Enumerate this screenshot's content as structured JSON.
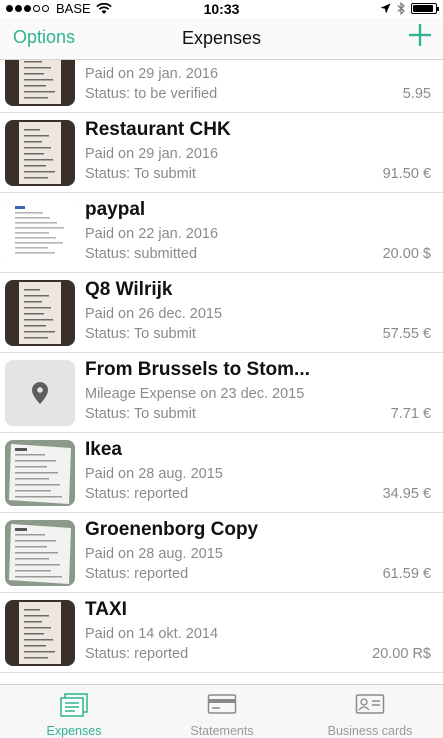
{
  "status_bar": {
    "carrier": "BASE",
    "time": "10:33",
    "battery_level": 0.92
  },
  "nav": {
    "left_label": "Options",
    "title": "Expenses",
    "add_icon": "plus-icon",
    "accent_color": "#2fb38f"
  },
  "expenses": [
    {
      "title": "",
      "line1": "Paid on 29 jan. 2016",
      "status": "Status: to be verified",
      "amount": "5.95",
      "thumb": "receipt-photo"
    },
    {
      "title": "Restaurant CHK",
      "line1": "Paid on 29 jan. 2016",
      "status": "Status: To submit",
      "amount": "91.50 €",
      "thumb": "receipt-photo"
    },
    {
      "title": "paypal",
      "line1": "Paid on 22 jan. 2016",
      "status": "Status: submitted",
      "amount": "20.00 $",
      "thumb": "document-scan"
    },
    {
      "title": "Q8 Wilrijk",
      "line1": "Paid on 26 dec. 2015",
      "status": "Status: To submit",
      "amount": "57.55 €",
      "thumb": "receipt-photo"
    },
    {
      "title": "From Brussels to Stom...",
      "line1": "Mileage Expense on 23 dec. 2015",
      "status": "Status: To submit",
      "amount": "7.71 €",
      "thumb": "location-pin-icon"
    },
    {
      "title": "Ikea",
      "line1": "Paid on 28 aug. 2015",
      "status": "Status: reported",
      "amount": "34.95 €",
      "thumb": "invoice-photo"
    },
    {
      "title": "Groenenborg Copy",
      "line1": "Paid on 28 aug. 2015",
      "status": "Status: reported",
      "amount": "61.59 €",
      "thumb": "invoice-photo"
    },
    {
      "title": "TAXI",
      "line1": "Paid on 14 okt. 2014",
      "status": "Status: reported",
      "amount": "20.00 R$",
      "thumb": "receipt-photo"
    }
  ],
  "tabs": [
    {
      "label": "Expenses",
      "icon": "receipts-icon",
      "active": true
    },
    {
      "label": "Statements",
      "icon": "card-icon",
      "active": false
    },
    {
      "label": "Business cards",
      "icon": "contact-card-icon",
      "active": false
    }
  ]
}
